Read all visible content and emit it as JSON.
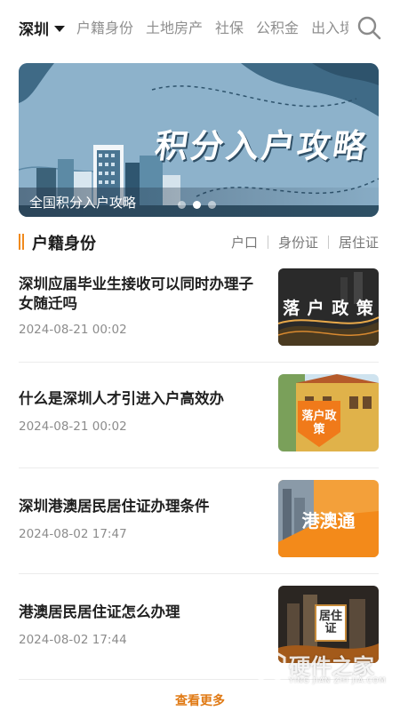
{
  "nav": {
    "city": "深圳",
    "categories": [
      "户籍身份",
      "土地房产",
      "社保",
      "公积金",
      "出入境"
    ]
  },
  "banner": {
    "title": "积分入户攻略",
    "caption": "全国积分入户攻略"
  },
  "section": {
    "title": "户籍身份",
    "tabs": [
      "户口",
      "身份证",
      "居住证"
    ]
  },
  "articles": [
    {
      "title": "深圳应届毕业生接收可以同时办理子女随迁吗",
      "date": "2024-08-21 00:02",
      "thumb_text": "落 户 政 策"
    },
    {
      "title": "什么是深圳人才引进入户高效办",
      "date": "2024-08-21 00:02",
      "thumb_text": "落户政策"
    },
    {
      "title": "深圳港澳居民居住证办理条件",
      "date": "2024-08-02 17:47",
      "thumb_text": "港澳通"
    },
    {
      "title": "港澳居民居住证怎么办理",
      "date": "2024-08-02 17:44",
      "thumb_text": "居住证"
    }
  ],
  "more_label": "查看更多",
  "watermark": {
    "text": "硬件之家",
    "sub": "YING JIAN ZHI JIA.COM"
  },
  "colors": {
    "accent": "#f08a1d",
    "more": "#e07a15"
  }
}
